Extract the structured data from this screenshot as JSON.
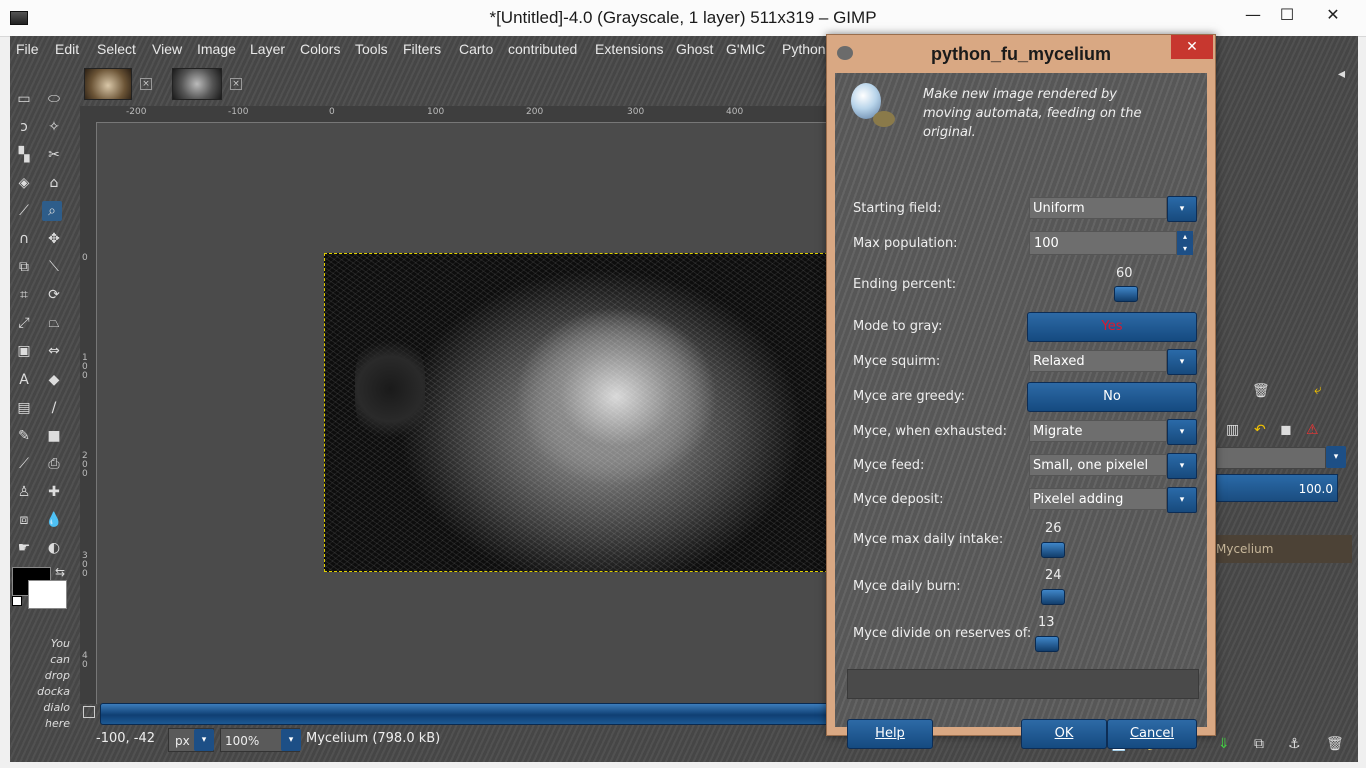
{
  "window": {
    "title": "*[Untitled]-4.0 (Grayscale, 1 layer) 511x319 – GIMP",
    "minimize": "—",
    "maximize": "☐",
    "close": "✕"
  },
  "menu": [
    "File",
    "Edit",
    "Select",
    "View",
    "Image",
    "Layer",
    "Colors",
    "Tools",
    "Filters",
    "Carto",
    "contributed",
    "Extensions",
    "Ghost",
    "G'MIC",
    "Python-"
  ],
  "toolbox": {
    "dock_hint": [
      "You",
      "can",
      "drop",
      "docka",
      "dialo",
      "here"
    ]
  },
  "rulers": {
    "h": [
      "-200",
      "-100",
      "0",
      "100",
      "200",
      "300",
      "400"
    ],
    "v": [
      "0",
      "1",
      "0",
      "0",
      "2",
      "0",
      "0",
      "3",
      "0",
      "0",
      "4",
      "0"
    ]
  },
  "status": {
    "coords": "-100, -42",
    "unit": "px",
    "zoom": "100",
    "zoom_unit": "%",
    "message": "Mycelium (798.0 kB)"
  },
  "layers": {
    "opacity": "100.0",
    "layer_name": "Mycelium"
  },
  "dialog": {
    "title": "python_fu_mycelium",
    "description": "Make new image rendered by moving automata, feeding on the original.",
    "fields": {
      "starting_field": {
        "label": "Starting field:",
        "value": "Uniform"
      },
      "max_population": {
        "label": "Max population:",
        "value": "100"
      },
      "ending_percent": {
        "label": "Ending percent:",
        "value": "60"
      },
      "mode_to_gray": {
        "label": "Mode to gray:",
        "value": "Yes"
      },
      "myce_squirm": {
        "label": "Myce squirm:",
        "value": "Relaxed"
      },
      "myce_greedy": {
        "label": "Myce are greedy:",
        "value": "No"
      },
      "myce_exhausted": {
        "label": "Myce, when exhausted:",
        "value": "Migrate"
      },
      "myce_feed": {
        "label": "Myce feed:",
        "value": "Small, one pixelel"
      },
      "myce_deposit": {
        "label": "Myce deposit:",
        "value": "Pixelel adding"
      },
      "myce_max_intake": {
        "label": "Myce max daily intake:",
        "value": "26"
      },
      "myce_daily_burn": {
        "label": "Myce daily burn:",
        "value": "24"
      },
      "myce_divide": {
        "label": "Myce divide on reserves of:",
        "value": "13"
      }
    },
    "buttons": {
      "help": "Help",
      "ok": "OK",
      "cancel": "Cancel"
    }
  },
  "colors": {
    "accent_blue": "#1d4f86",
    "toggle_yes_text": "#e0182c",
    "dialog_frame": "#d9a883"
  }
}
